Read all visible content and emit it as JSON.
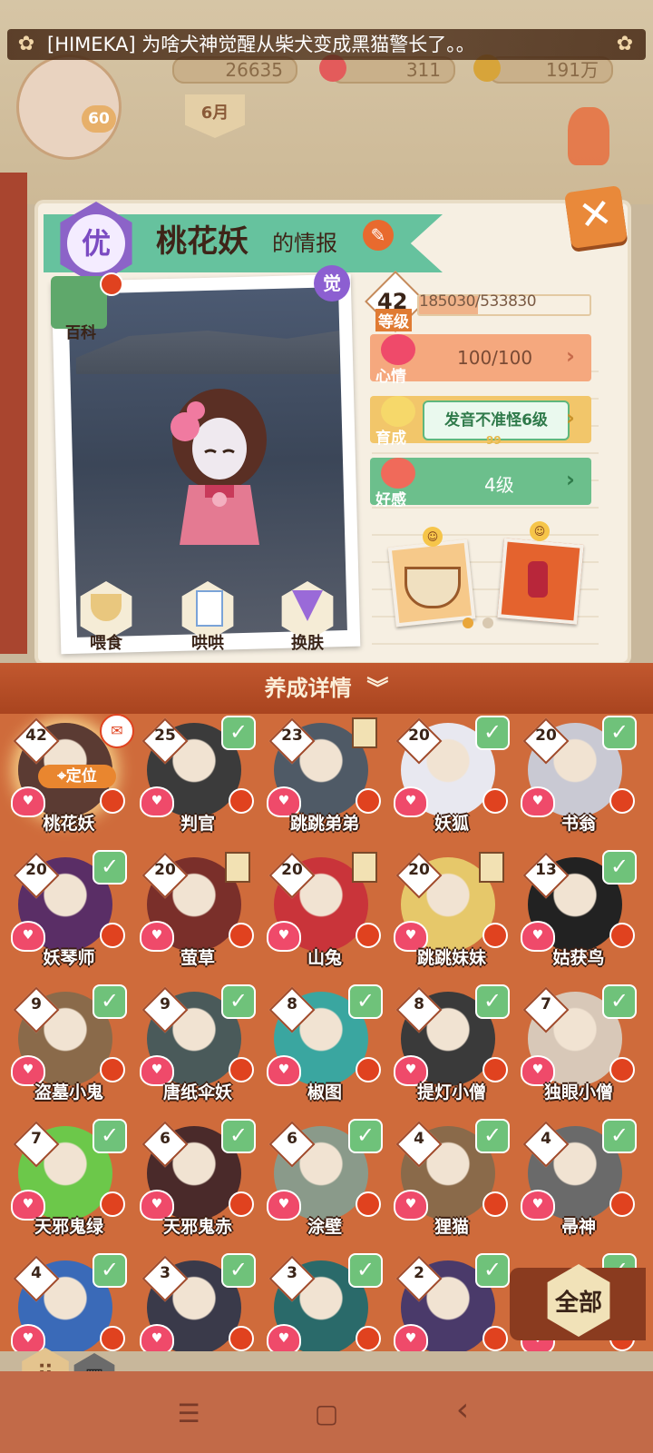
{
  "hud": {
    "avatar_level": "60",
    "resource_1": "26635",
    "resource_2": "311",
    "resource_3": "191万",
    "date_label": "6月",
    "marquee": "[HIMEKA] 为啥犬神觉醒从柴犬变成黑猫警长了。。"
  },
  "card": {
    "rank_badge": "优",
    "name": "桃花妖",
    "name_suffix": "的情报",
    "awaken_badge": "觉",
    "encyclopedia": "百科",
    "close_icon": "✕"
  },
  "actions": [
    {
      "label": "喂食"
    },
    {
      "label": "哄哄"
    },
    {
      "label": "换肤"
    }
  ],
  "stats": {
    "level": "42",
    "level_label": "等级",
    "exp": "185030/533830",
    "exp_fraction": 0.347,
    "mood_label": "心情",
    "mood_value": "100/100",
    "cultivate_label": "育成",
    "cultivate_tag": "发音不准怪6级",
    "cultivate_sub": "99",
    "affection_label": "好感",
    "affection_value": "4级"
  },
  "detail_bar": {
    "label": "养成详情"
  },
  "shikigami": [
    {
      "name": "桃花妖",
      "level": "42",
      "mark": "msg",
      "locate": "定位",
      "color": "#5b3b33"
    },
    {
      "name": "判官",
      "level": "25",
      "mark": "check",
      "color": "#3b3b3b"
    },
    {
      "name": "跳跳弟弟",
      "level": "23",
      "mark": "stand",
      "color": "#4f5a66"
    },
    {
      "name": "妖狐",
      "level": "20",
      "mark": "check",
      "color": "#e8e8f0"
    },
    {
      "name": "书翁",
      "level": "20",
      "mark": "check",
      "color": "#c9c9d3"
    },
    {
      "name": "妖琴师",
      "level": "20",
      "mark": "check",
      "color": "#5a2e66"
    },
    {
      "name": "萤草",
      "level": "20",
      "mark": "stand",
      "color": "#7a2f2a"
    },
    {
      "name": "山兔",
      "level": "20",
      "mark": "stand",
      "color": "#c9343a"
    },
    {
      "name": "跳跳妹妹",
      "level": "20",
      "mark": "stand",
      "color": "#e6c86a"
    },
    {
      "name": "姑获鸟",
      "level": "13",
      "mark": "check",
      "color": "#222222"
    },
    {
      "name": "盗墓小鬼",
      "level": "9",
      "mark": "check",
      "color": "#8a6a4a"
    },
    {
      "name": "唐纸伞妖",
      "level": "9",
      "mark": "check",
      "color": "#4a5a5a"
    },
    {
      "name": "椒图",
      "level": "8",
      "mark": "check",
      "color": "#3aa6a0"
    },
    {
      "name": "提灯小僧",
      "level": "8",
      "mark": "check",
      "color": "#3a3a3a"
    },
    {
      "name": "独眼小僧",
      "level": "7",
      "mark": "check",
      "color": "#d8c8b8"
    },
    {
      "name": "天邪鬼绿",
      "level": "7",
      "mark": "check",
      "color": "#6cc84a"
    },
    {
      "name": "天邪鬼赤",
      "level": "6",
      "mark": "check",
      "color": "#4a2a2a"
    },
    {
      "name": "涂壁",
      "level": "6",
      "mark": "check",
      "color": "#8a9a8a"
    },
    {
      "name": "狸猫",
      "level": "4",
      "mark": "check",
      "color": "#8a6a4a"
    },
    {
      "name": "帚神",
      "level": "4",
      "mark": "check",
      "color": "#6a6a6a"
    },
    {
      "name": "",
      "level": "4",
      "mark": "check",
      "color": "#3a6ab8"
    },
    {
      "name": "",
      "level": "3",
      "mark": "check",
      "color": "#3a3a4a"
    },
    {
      "name": "",
      "level": "3",
      "mark": "check",
      "color": "#2a6a6a"
    },
    {
      "name": "",
      "level": "2",
      "mark": "check",
      "color": "#4a3a6a"
    },
    {
      "name": "",
      "level": "",
      "mark": "check",
      "color": "#cf6b3b"
    }
  ],
  "filter": {
    "label": "全部"
  },
  "view": {
    "grid_icon": "⣿",
    "list_icon": "▦"
  },
  "nav": {
    "menu": "☰",
    "home": "▢",
    "back": "‹"
  },
  "colors": {
    "ribbon": "#66c29e",
    "mood": "#f5a87e",
    "cultivate": "#f2c66a",
    "affection": "#6cbf8c",
    "grid_bg": "#cf6b3b"
  }
}
